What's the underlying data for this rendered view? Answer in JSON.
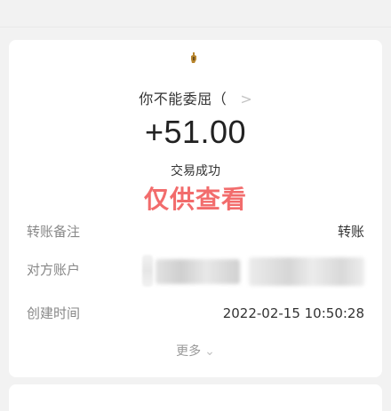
{
  "payer": {
    "name": "你不能委屈（",
    "chevron_icon": "chevron-right-icon"
  },
  "amount": "+51.00",
  "status": "交易成功",
  "watermark": "仅供查看",
  "details": [
    {
      "label": "转账备注",
      "value": "转账"
    },
    {
      "label": "对方账户",
      "value": ""
    },
    {
      "label": "创建时间",
      "value": "2022-02-15 10:50:28"
    }
  ],
  "more_label": "更多",
  "colors": {
    "watermark": "#f26c6c",
    "background": "#f2f2f2",
    "card": "#ffffff"
  }
}
